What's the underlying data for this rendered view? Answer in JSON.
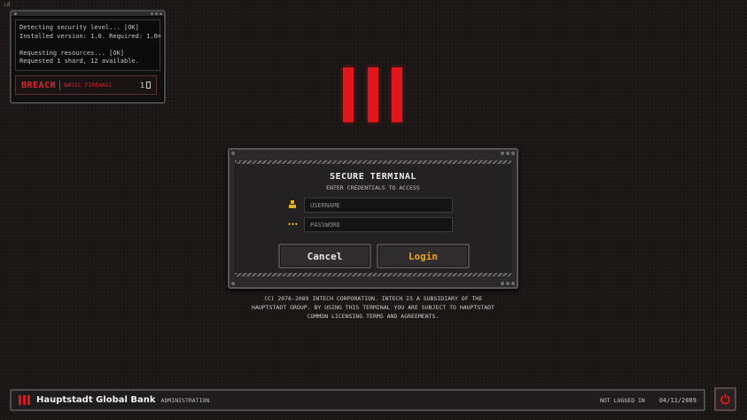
{
  "corner_mark": "ıd",
  "console": {
    "log_lines": [
      "Detecting security level... [OK]",
      "Installed version: 1.0. Required: 1.0+",
      "",
      "Requesting resources... [OK]",
      "Requested 1 shard, 12 available."
    ],
    "breach_title": "BREACH",
    "breach_subtitle": "BASIC FIREWALL",
    "shard_count": "1"
  },
  "login": {
    "title": "SECURE TERMINAL",
    "subtitle": "ENTER CREDENTIALS TO ACCESS",
    "username_placeholder": "USERNAME",
    "password_placeholder": "PASSWORD",
    "password_icon": "•••",
    "cancel_label": "Cancel",
    "login_label": "Login"
  },
  "copyright": "(C) 2076-2089 INTECH CORPORATION. INTECH IS A SUBSIDIARY OF THE HAUPTSTADT GROUP. BY USING THIS TERMINAL YOU ARE SUBJECT TO HAUPTSTADT COMMON LICENSING TERMS AND AGREEMENTS.",
  "bottombar": {
    "bank_name": "Hauptstadt Global Bank",
    "role": "ADMINISTRATION",
    "status": "NOT LOGGED IN",
    "date": "04/11/2089"
  },
  "colors": {
    "accent_red": "#e0161d",
    "login_orange": "#f0a21a",
    "user_icon_yellow": "#e8b020"
  },
  "icons": [
    "logo-bars-icon",
    "user-icon",
    "password-dots-icon",
    "shard-icon",
    "power-icon"
  ]
}
